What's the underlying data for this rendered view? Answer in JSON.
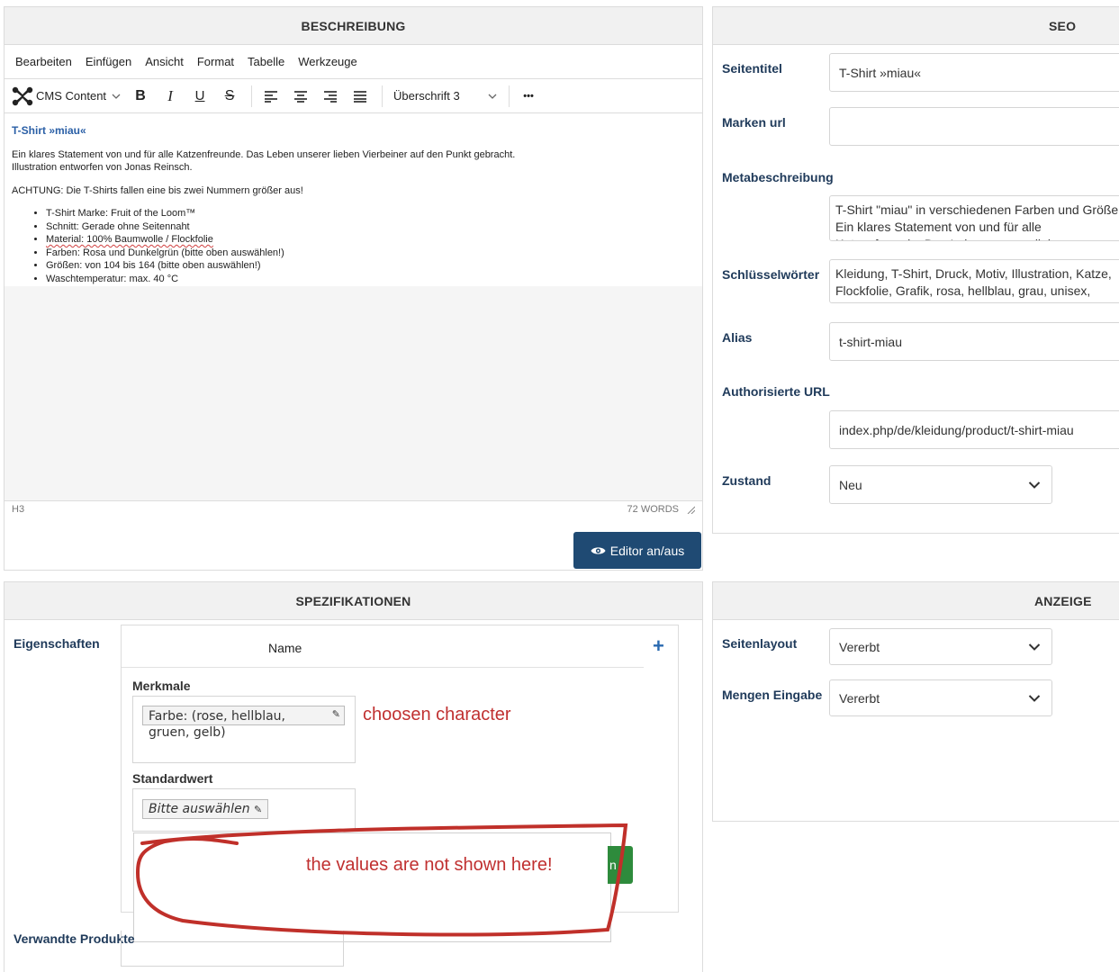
{
  "beschreibung": {
    "header": "BESCHREIBUNG",
    "menu": [
      "Bearbeiten",
      "Einfügen",
      "Ansicht",
      "Format",
      "Tabelle",
      "Werkzeuge"
    ],
    "toolbar": {
      "cms_content": "CMS Content",
      "heading_select": "Überschrift 3",
      "more": "•••"
    },
    "doc": {
      "title": "T-Shirt »miau«",
      "para1": "Ein klares Statement von und für alle Katzenfreunde. Das Leben unserer lieben Vierbeiner auf den Punkt gebracht.",
      "para1b": "Illustration entworfen von Jonas Reinsch.",
      "para2": "ACHTUNG: Die T-Shirts fallen eine bis zwei Nummern größer aus!",
      "bullets": [
        "T-Shirt Marke: Fruit of the Loom™",
        "Schnitt: Gerade ohne Seitennaht",
        "Material: 100% Baumwolle / Flockfolie",
        "Farben: Rosa und Dunkelgrün (bitte oben auswählen!)",
        "Größen: von 104 bis 164 (bitte oben auswählen!)",
        "Waschtemperatur: max. 40 °C"
      ]
    },
    "status_left": "H3",
    "status_right": "72 WORDS",
    "toggle_button": "Editor an/aus"
  },
  "seo": {
    "header": "SEO",
    "seitentitel_label": "Seitentitel",
    "seitentitel_value": "T-Shirt »miau«",
    "marken_label": "Marken url",
    "marken_value": "",
    "meta_label": "Metabeschreibung",
    "meta_value": "T-Shirt \"miau\" in verschiedenen Farben und Größen. Ein klares Statement von und für alle Katzenfreunde. Das Leben unserer lieben Vierbeiner auf den Punkt gebracht.",
    "keywords_label": "Schlüsselwörter",
    "keywords_value": "Kleidung, T-Shirt, Druck, Motiv, Illustration, Katze, Flockfolie, Grafik, rosa, hellblau, grau, unisex, Damen",
    "alias_label": "Alias",
    "alias_value": "t-shirt-miau",
    "auth_label": "Authorisierte URL",
    "auth_value": "index.php/de/kleidung/product/t-shirt-miau",
    "zustand_label": "Zustand",
    "zustand_value": "Neu"
  },
  "spezifikationen": {
    "header": "SPEZIFIKATIONEN",
    "eigenschaften_label": "Eigenschaften",
    "name_col": "Name",
    "merkmale_label": "Merkmale",
    "merkmale_tag": "Farbe: (rose, hellblau, gruen, gelb)",
    "standardwert_label": "Standardwert",
    "standardwert_tag": "Bitte auswählen",
    "verwandte_label": "Verwandte Produkte",
    "hidden_button": "n"
  },
  "anzeige": {
    "header": "ANZEIGE",
    "seitenlayout_label": "Seitenlayout",
    "seitenlayout_value": "Vererbt",
    "mengen_label": "Mengen Eingabe",
    "mengen_value": "Vererbt"
  },
  "annotations": {
    "note1": "choosen character",
    "note2": "the values are not shown here!"
  },
  "colors": {
    "accent_dark": "#1f4a73",
    "annotation_red": "#c03030",
    "label_blue": "#1f3a5a"
  }
}
